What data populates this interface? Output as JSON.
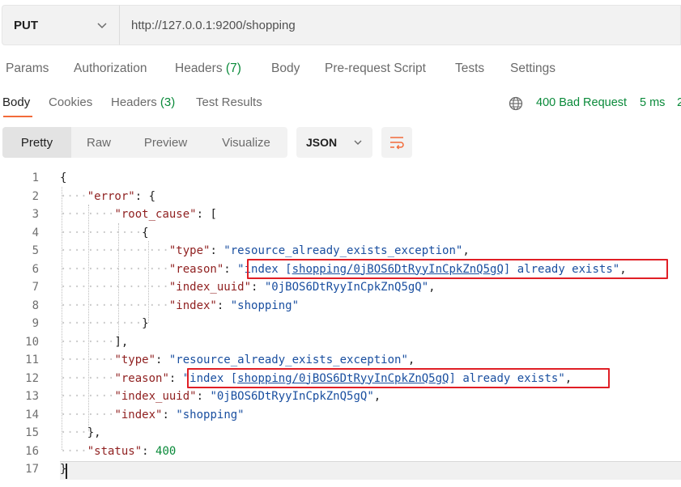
{
  "request": {
    "method": "PUT",
    "url": "http://127.0.0.1:9200/shopping"
  },
  "request_tabs": {
    "params": "Params",
    "authorization": "Authorization",
    "headers": "Headers",
    "headers_count": "(7)",
    "body": "Body",
    "prerequest": "Pre-request Script",
    "tests": "Tests",
    "settings": "Settings"
  },
  "response_tabs": {
    "body": "Body",
    "cookies": "Cookies",
    "headers": "Headers",
    "headers_count": "(3)",
    "test_results": "Test Results"
  },
  "response_status": {
    "status": "400 Bad Request",
    "time": "5 ms",
    "size_partial": "2"
  },
  "format": {
    "pretty": "Pretty",
    "raw": "Raw",
    "preview": "Preview",
    "visualize": "Visualize",
    "language": "JSON"
  },
  "code_lines": {
    "n1": "1",
    "n2": "2",
    "n3": "3",
    "n4": "4",
    "n5": "5",
    "n6": "6",
    "n7": "7",
    "n8": "8",
    "n9": "9",
    "n10": "10",
    "n11": "11",
    "n12": "12",
    "n13": "13",
    "n14": "14",
    "n15": "15",
    "n16": "16",
    "n17": "17",
    "k_error": "\"error\"",
    "k_root_cause": "\"root_cause\"",
    "k_type": "\"type\"",
    "k_reason": "\"reason\"",
    "k_index_uuid": "\"index_uuid\"",
    "k_index": "\"index\"",
    "k_status": "\"status\"",
    "v_type": "\"resource_already_exists_exception\"",
    "v_reason_pre": "\"index [",
    "v_reason_link": "shopping/0jBOS6DtRyyInCpkZnQ5gQ",
    "v_reason_post": "] already exists\"",
    "v_uuid": "\"0jBOS6DtRyyInCpkZnQ5gQ\"",
    "v_index": "\"shopping\"",
    "v_status": "400"
  },
  "colors": {
    "accent": "#f26b3a",
    "success_text": "#0a8a3a",
    "highlight_box": "#e01f26"
  }
}
